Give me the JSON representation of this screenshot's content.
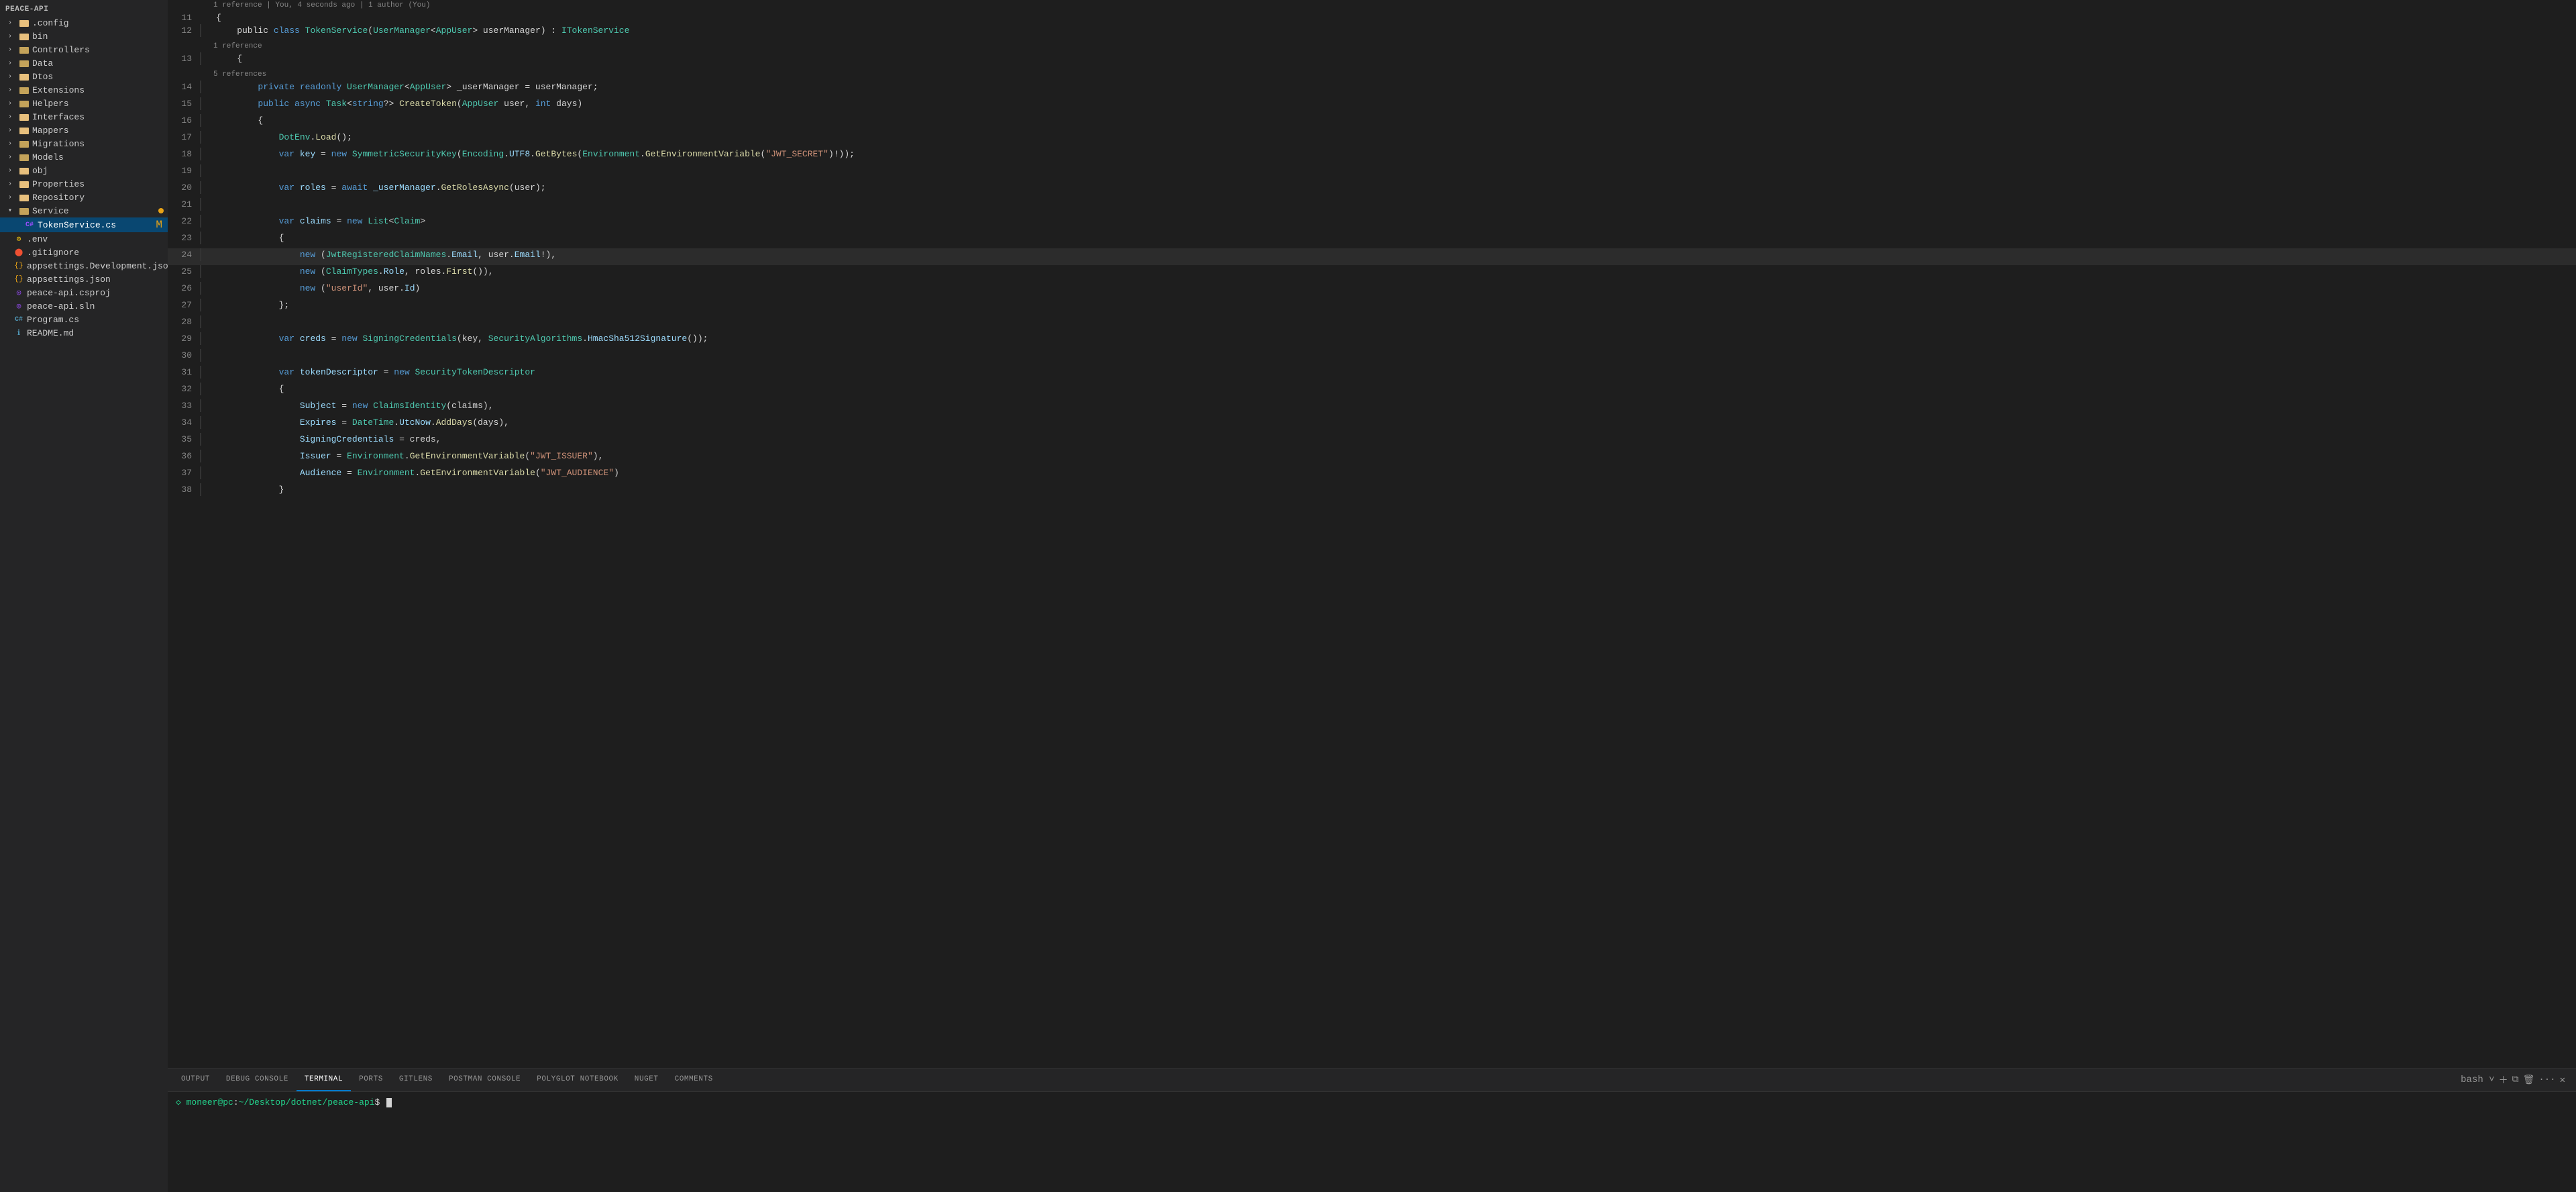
{
  "sidebar": {
    "root_label": "PEACE-API",
    "items": [
      {
        "id": "config",
        "label": ".config",
        "indent": 1,
        "type": "folder",
        "arrow": "›",
        "collapsed": true
      },
      {
        "id": "bin",
        "label": "bin",
        "indent": 1,
        "type": "folder",
        "arrow": "›",
        "collapsed": true
      },
      {
        "id": "controllers",
        "label": "Controllers",
        "indent": 1,
        "type": "folder-src",
        "arrow": "›",
        "collapsed": true
      },
      {
        "id": "data",
        "label": "Data",
        "indent": 1,
        "type": "folder-src",
        "arrow": "›",
        "collapsed": true
      },
      {
        "id": "dtos",
        "label": "Dtos",
        "indent": 1,
        "type": "folder",
        "arrow": "›",
        "collapsed": true
      },
      {
        "id": "extensions",
        "label": "Extensions",
        "indent": 1,
        "type": "folder-src",
        "arrow": "›",
        "collapsed": true
      },
      {
        "id": "helpers",
        "label": "Helpers",
        "indent": 1,
        "type": "folder-src",
        "arrow": "›",
        "collapsed": true
      },
      {
        "id": "interfaces",
        "label": "Interfaces",
        "indent": 1,
        "type": "folder",
        "arrow": "›",
        "collapsed": true
      },
      {
        "id": "mappers",
        "label": "Mappers",
        "indent": 1,
        "type": "folder",
        "arrow": "›",
        "collapsed": true
      },
      {
        "id": "migrations",
        "label": "Migrations",
        "indent": 1,
        "type": "folder-src",
        "arrow": "›",
        "collapsed": true
      },
      {
        "id": "models",
        "label": "Models",
        "indent": 1,
        "type": "folder-src",
        "arrow": "›",
        "collapsed": true
      },
      {
        "id": "obj",
        "label": "obj",
        "indent": 1,
        "type": "folder",
        "arrow": "›",
        "collapsed": true
      },
      {
        "id": "properties",
        "label": "Properties",
        "indent": 1,
        "type": "folder",
        "arrow": "›",
        "collapsed": true
      },
      {
        "id": "repository",
        "label": "Repository",
        "indent": 1,
        "type": "folder",
        "arrow": "›",
        "collapsed": true
      },
      {
        "id": "service",
        "label": "Service",
        "indent": 1,
        "type": "folder-src",
        "arrow": "˅",
        "collapsed": false,
        "has_badge": true
      },
      {
        "id": "tokenservice",
        "label": "TokenService.cs",
        "indent": 2,
        "type": "cs",
        "arrow": "",
        "active": true,
        "modified": true
      },
      {
        "id": "env",
        "label": ".env",
        "indent": 0,
        "type": "env",
        "arrow": ""
      },
      {
        "id": "gitignore",
        "label": ".gitignore",
        "indent": 0,
        "type": "git",
        "arrow": ""
      },
      {
        "id": "appsettings_dev",
        "label": "appsettings.Development.json",
        "indent": 0,
        "type": "json",
        "arrow": ""
      },
      {
        "id": "appsettings",
        "label": "appsettings.json",
        "indent": 0,
        "type": "json",
        "arrow": ""
      },
      {
        "id": "csproj",
        "label": "peace-api.csproj",
        "indent": 0,
        "type": "csproj",
        "arrow": ""
      },
      {
        "id": "sln",
        "label": "peace-api.sln",
        "indent": 0,
        "type": "sln",
        "arrow": ""
      },
      {
        "id": "program",
        "label": "Program.cs",
        "indent": 0,
        "type": "program",
        "arrow": ""
      },
      {
        "id": "readme",
        "label": "README.md",
        "indent": 0,
        "type": "readme",
        "arrow": ""
      }
    ]
  },
  "code": {
    "reference_header": "1 reference | You, 4 seconds ago | 1 author (You)",
    "lines": [
      {
        "num": 11,
        "tokens": [
          {
            "t": "{",
            "c": "punc"
          }
        ]
      },
      {
        "num": 12,
        "tokens": [
          {
            "t": "    public ",
            "c": "plain"
          },
          {
            "t": "class ",
            "c": "kw"
          },
          {
            "t": "TokenService",
            "c": "type"
          },
          {
            "t": "(",
            "c": "punc"
          },
          {
            "t": "UserManager",
            "c": "type"
          },
          {
            "t": "<",
            "c": "punc"
          },
          {
            "t": "AppUser",
            "c": "type"
          },
          {
            "t": "> userManager) : ",
            "c": "plain"
          },
          {
            "t": "ITokenService",
            "c": "type"
          }
        ]
      },
      {
        "num": 13,
        "tokens": [
          {
            "t": "    {",
            "c": "punc"
          }
        ]
      },
      {
        "num": 14,
        "tokens": [
          {
            "t": "        ",
            "c": "plain"
          },
          {
            "t": "private readonly ",
            "c": "kw"
          },
          {
            "t": "UserManager",
            "c": "type"
          },
          {
            "t": "<",
            "c": "punc"
          },
          {
            "t": "AppUser",
            "c": "type"
          },
          {
            "t": "> _userManager = userManager;",
            "c": "plain"
          }
        ]
      },
      {
        "num": 15,
        "tokens": [
          {
            "t": "        ",
            "c": "plain"
          },
          {
            "t": "public async ",
            "c": "kw"
          },
          {
            "t": "Task",
            "c": "type"
          },
          {
            "t": "<",
            "c": "punc"
          },
          {
            "t": "string",
            "c": "kw"
          },
          {
            "t": "?> ",
            "c": "plain"
          },
          {
            "t": "CreateToken",
            "c": "func"
          },
          {
            "t": "(",
            "c": "punc"
          },
          {
            "t": "AppUser",
            "c": "type"
          },
          {
            "t": " user, ",
            "c": "plain"
          },
          {
            "t": "int",
            "c": "kw"
          },
          {
            "t": " days)",
            "c": "plain"
          }
        ]
      },
      {
        "num": 16,
        "tokens": [
          {
            "t": "        {",
            "c": "punc"
          }
        ]
      },
      {
        "num": 17,
        "tokens": [
          {
            "t": "            ",
            "c": "plain"
          },
          {
            "t": "DotEnv",
            "c": "type"
          },
          {
            "t": ".",
            "c": "punc"
          },
          {
            "t": "Load",
            "c": "func"
          },
          {
            "t": "();",
            "c": "punc"
          }
        ]
      },
      {
        "num": 18,
        "tokens": [
          {
            "t": "            ",
            "c": "plain"
          },
          {
            "t": "var ",
            "c": "kw"
          },
          {
            "t": "key",
            "c": "var"
          },
          {
            "t": " = ",
            "c": "op"
          },
          {
            "t": "new ",
            "c": "kw"
          },
          {
            "t": "SymmetricSecurityKey",
            "c": "type"
          },
          {
            "t": "(",
            "c": "punc"
          },
          {
            "t": "Encoding",
            "c": "type"
          },
          {
            "t": ".",
            "c": "punc"
          },
          {
            "t": "UTF8",
            "c": "prop"
          },
          {
            "t": ".",
            "c": "punc"
          },
          {
            "t": "GetBytes",
            "c": "func"
          },
          {
            "t": "(",
            "c": "punc"
          },
          {
            "t": "Environment",
            "c": "type"
          },
          {
            "t": ".",
            "c": "punc"
          },
          {
            "t": "GetEnvironmentVariable",
            "c": "func"
          },
          {
            "t": "(",
            "c": "punc"
          },
          {
            "t": "\"JWT_SECRET\"",
            "c": "str"
          },
          {
            "t": ")!));",
            "c": "punc"
          }
        ]
      },
      {
        "num": 19,
        "tokens": []
      },
      {
        "num": 20,
        "tokens": [
          {
            "t": "            ",
            "c": "plain"
          },
          {
            "t": "var ",
            "c": "kw"
          },
          {
            "t": "roles",
            "c": "var"
          },
          {
            "t": " = ",
            "c": "op"
          },
          {
            "t": "await ",
            "c": "kw"
          },
          {
            "t": "_userManager",
            "c": "var"
          },
          {
            "t": ".",
            "c": "punc"
          },
          {
            "t": "GetRolesAsync",
            "c": "func"
          },
          {
            "t": "(user);",
            "c": "punc"
          }
        ]
      },
      {
        "num": 21,
        "tokens": []
      },
      {
        "num": 22,
        "tokens": [
          {
            "t": "            ",
            "c": "plain"
          },
          {
            "t": "var ",
            "c": "kw"
          },
          {
            "t": "claims",
            "c": "var"
          },
          {
            "t": " = ",
            "c": "op"
          },
          {
            "t": "new ",
            "c": "kw"
          },
          {
            "t": "List",
            "c": "type"
          },
          {
            "t": "<",
            "c": "punc"
          },
          {
            "t": "Claim",
            "c": "type"
          },
          {
            "t": ">",
            "c": "punc"
          }
        ]
      },
      {
        "num": 23,
        "tokens": [
          {
            "t": "            {",
            "c": "punc"
          }
        ]
      },
      {
        "num": 24,
        "tokens": [
          {
            "t": "                ",
            "c": "plain"
          },
          {
            "t": "new ",
            "c": "kw"
          },
          {
            "t": "(",
            "c": "punc"
          },
          {
            "t": "JwtRegisteredClaimNames",
            "c": "type"
          },
          {
            "t": ".",
            "c": "punc"
          },
          {
            "t": "Email",
            "c": "prop"
          },
          {
            "t": ", user.",
            "c": "plain"
          },
          {
            "t": "Email",
            "c": "prop"
          },
          {
            "t": "!),",
            "c": "punc"
          }
        ]
      },
      {
        "num": 25,
        "tokens": [
          {
            "t": "                ",
            "c": "plain"
          },
          {
            "t": "new ",
            "c": "kw"
          },
          {
            "t": "(",
            "c": "punc"
          },
          {
            "t": "ClaimTypes",
            "c": "type"
          },
          {
            "t": ".",
            "c": "punc"
          },
          {
            "t": "Role",
            "c": "prop"
          },
          {
            "t": ", roles.",
            "c": "plain"
          },
          {
            "t": "First",
            "c": "func"
          },
          {
            "t": "()),",
            "c": "punc"
          }
        ]
      },
      {
        "num": 26,
        "tokens": [
          {
            "t": "                ",
            "c": "plain"
          },
          {
            "t": "new ",
            "c": "kw"
          },
          {
            "t": "(",
            "c": "punc"
          },
          {
            "t": "\"userId\"",
            "c": "str"
          },
          {
            "t": ", user.",
            "c": "plain"
          },
          {
            "t": "Id",
            "c": "prop"
          },
          {
            "t": ")",
            "c": "punc"
          }
        ]
      },
      {
        "num": 27,
        "tokens": [
          {
            "t": "            };",
            "c": "punc"
          }
        ]
      },
      {
        "num": 28,
        "tokens": []
      },
      {
        "num": 29,
        "tokens": [
          {
            "t": "            ",
            "c": "plain"
          },
          {
            "t": "var ",
            "c": "kw"
          },
          {
            "t": "creds",
            "c": "var"
          },
          {
            "t": " = ",
            "c": "op"
          },
          {
            "t": "new ",
            "c": "kw"
          },
          {
            "t": "SigningCredentials",
            "c": "type"
          },
          {
            "t": "(key, ",
            "c": "plain"
          },
          {
            "t": "SecurityAlgorithms",
            "c": "type"
          },
          {
            "t": ".",
            "c": "punc"
          },
          {
            "t": "HmacSha512Signature",
            "c": "prop"
          },
          {
            "t": "());",
            "c": "punc"
          }
        ]
      },
      {
        "num": 30,
        "tokens": []
      },
      {
        "num": 31,
        "tokens": [
          {
            "t": "            ",
            "c": "plain"
          },
          {
            "t": "var ",
            "c": "kw"
          },
          {
            "t": "tokenDescriptor",
            "c": "var"
          },
          {
            "t": " = ",
            "c": "op"
          },
          {
            "t": "new ",
            "c": "kw"
          },
          {
            "t": "SecurityTokenDescriptor",
            "c": "type"
          }
        ]
      },
      {
        "num": 32,
        "tokens": [
          {
            "t": "            {",
            "c": "punc"
          }
        ]
      },
      {
        "num": 33,
        "tokens": [
          {
            "t": "                ",
            "c": "plain"
          },
          {
            "t": "Subject",
            "c": "prop"
          },
          {
            "t": " = ",
            "c": "op"
          },
          {
            "t": "new ",
            "c": "kw"
          },
          {
            "t": "ClaimsIdentity",
            "c": "type"
          },
          {
            "t": "(claims),",
            "c": "punc"
          }
        ]
      },
      {
        "num": 34,
        "tokens": [
          {
            "t": "                ",
            "c": "plain"
          },
          {
            "t": "Expires",
            "c": "prop"
          },
          {
            "t": " = ",
            "c": "op"
          },
          {
            "t": "DateTime",
            "c": "type"
          },
          {
            "t": ".",
            "c": "punc"
          },
          {
            "t": "UtcNow",
            "c": "prop"
          },
          {
            "t": ".",
            "c": "punc"
          },
          {
            "t": "AddDays",
            "c": "func"
          },
          {
            "t": "(days),",
            "c": "punc"
          }
        ]
      },
      {
        "num": 35,
        "tokens": [
          {
            "t": "                ",
            "c": "plain"
          },
          {
            "t": "SigningCredentials",
            "c": "prop"
          },
          {
            "t": " = creds,",
            "c": "plain"
          }
        ]
      },
      {
        "num": 36,
        "tokens": [
          {
            "t": "                ",
            "c": "plain"
          },
          {
            "t": "Issuer",
            "c": "prop"
          },
          {
            "t": " = ",
            "c": "op"
          },
          {
            "t": "Environment",
            "c": "type"
          },
          {
            "t": ".",
            "c": "punc"
          },
          {
            "t": "GetEnvironmentVariable",
            "c": "func"
          },
          {
            "t": "(",
            "c": "punc"
          },
          {
            "t": "\"JWT_ISSUER\"",
            "c": "str"
          },
          {
            "t": "),",
            "c": "punc"
          }
        ]
      },
      {
        "num": 37,
        "tokens": [
          {
            "t": "                ",
            "c": "plain"
          },
          {
            "t": "Audience",
            "c": "prop"
          },
          {
            "t": " = ",
            "c": "op"
          },
          {
            "t": "Environment",
            "c": "type"
          },
          {
            "t": ".",
            "c": "punc"
          },
          {
            "t": "GetEnvironmentVariable",
            "c": "func"
          },
          {
            "t": "(",
            "c": "punc"
          },
          {
            "t": "\"JWT_AUDIENCE\"",
            "c": "str"
          },
          {
            "t": ")",
            "c": "punc"
          }
        ]
      },
      {
        "num": 38,
        "tokens": [
          {
            "t": "            }",
            "c": "punc"
          }
        ]
      }
    ],
    "ref_lines": {
      "11": "1 reference | You, 4 seconds ago | 1 author (You)",
      "13": "1 reference",
      "14": "5 references"
    }
  },
  "bottom_panel": {
    "tabs": [
      {
        "id": "output",
        "label": "OUTPUT"
      },
      {
        "id": "debug_console",
        "label": "DEBUG CONSOLE"
      },
      {
        "id": "terminal",
        "label": "TERMINAL",
        "active": true
      },
      {
        "id": "ports",
        "label": "PORTS"
      },
      {
        "id": "gitlens",
        "label": "GITLENS"
      },
      {
        "id": "postman_console",
        "label": "POSTMAN CONSOLE"
      },
      {
        "id": "polyglot_notebook",
        "label": "POLYGLOT NOTEBOOK"
      },
      {
        "id": "nuget",
        "label": "NUGET"
      },
      {
        "id": "comments",
        "label": "COMMENTS"
      }
    ],
    "terminal": {
      "prompt": "◇ moneer@pc:~/Desktop/dotnet/peace-api$"
    },
    "actions": [
      "+",
      "⊟",
      "🗑",
      "…",
      "✕"
    ]
  }
}
